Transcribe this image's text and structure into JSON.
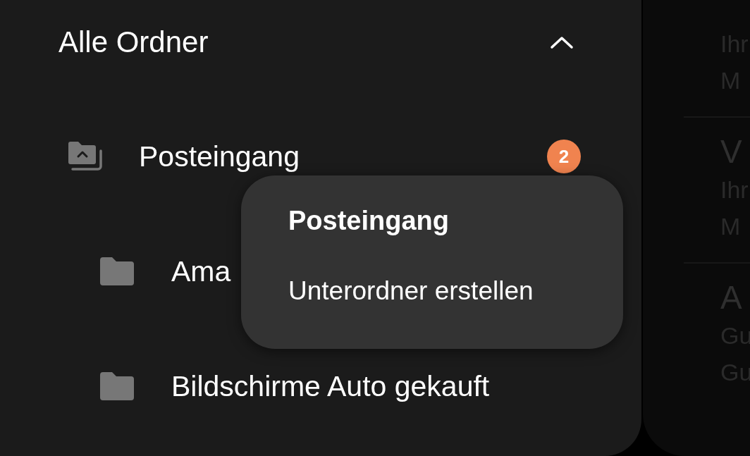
{
  "drawer": {
    "title": "Alle Ordner",
    "expanded": true,
    "folders": [
      {
        "name": "Posteingang",
        "kind": "inbox",
        "badge": "2",
        "children": [
          {
            "name": "Ama",
            "kind": "folder"
          },
          {
            "name": "Bildschirme Auto gekauft",
            "kind": "folder"
          }
        ]
      }
    ]
  },
  "context_menu": {
    "title": "Posteingang",
    "items": [
      "Unterordner erstellen"
    ]
  },
  "message_list": [
    {
      "lines": [
        "Ihr",
        "M"
      ]
    },
    {
      "title": "V",
      "lines": [
        "Ihr",
        "M"
      ]
    },
    {
      "title": "A",
      "lines": [
        "Gu",
        "Gu"
      ]
    }
  ]
}
